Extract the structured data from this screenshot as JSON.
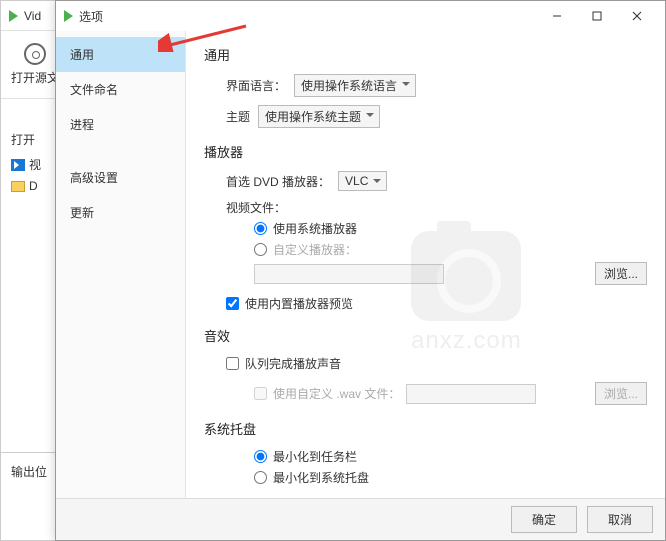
{
  "bg": {
    "title": "Vid",
    "open_source": "打开源文",
    "open_head": "打开",
    "item_video": "视",
    "item_d": "D",
    "output_loc": "输出位"
  },
  "dialog": {
    "title": "选项",
    "sidebar": {
      "general": "通用",
      "filenaming": "文件命名",
      "progress": "进程",
      "advanced": "高级设置",
      "update": "更新"
    },
    "content": {
      "general_title": "通用",
      "ui_lang_label": "界面语言：",
      "ui_lang_value": "使用操作系统语言",
      "theme_label": "主题",
      "theme_value": "使用操作系统主题",
      "player_title": "播放器",
      "dvd_label": "首选 DVD 播放器：",
      "dvd_value": "VLC",
      "video_files_label": "视频文件：",
      "radio_system_player": "使用系统播放器",
      "radio_custom_player": "自定义播放器：",
      "browse": "浏览...",
      "check_builtin_preview": "使用内置播放器预览",
      "audio_title": "音效",
      "check_queue_done_sound": "队列完成播放声音",
      "check_custom_wav": "使用自定义 .wav 文件：",
      "tray_title": "系统托盘",
      "radio_min_taskbar": "最小化到任务栏",
      "radio_min_tray": "最小化到系统托盘"
    },
    "footer": {
      "ok": "确定",
      "cancel": "取消"
    }
  },
  "watermark": "anxz.com"
}
